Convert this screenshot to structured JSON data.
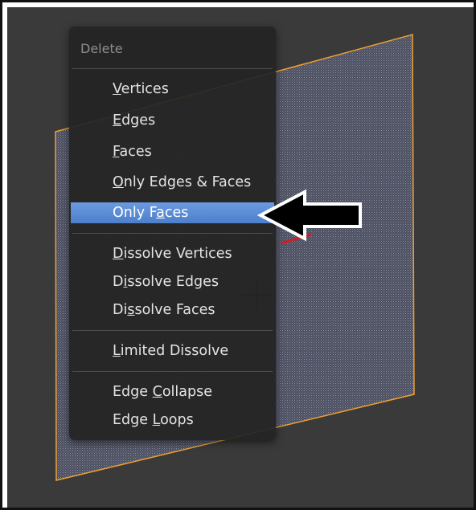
{
  "menu": {
    "title": "Delete",
    "items": [
      {
        "pre": "",
        "key": "V",
        "post": "ertices"
      },
      {
        "pre": "",
        "key": "E",
        "post": "dges"
      },
      {
        "pre": "",
        "key": "F",
        "post": "aces"
      },
      {
        "pre": "",
        "key": "O",
        "post": "nly Edges & Faces"
      },
      {
        "pre": "Only F",
        "key": "a",
        "post": "ces"
      },
      {
        "pre": "",
        "key": "D",
        "post": "issolve Vertices"
      },
      {
        "pre": "D",
        "key": "i",
        "post": "ssolve Edges"
      },
      {
        "pre": "Di",
        "key": "s",
        "post": "solve Faces"
      },
      {
        "pre": "",
        "key": "L",
        "post": "imited Dissolve"
      },
      {
        "pre": "Edge ",
        "key": "C",
        "post": "ollapse"
      },
      {
        "pre": "Edge ",
        "key": "L",
        "post": "oops"
      }
    ],
    "active_item": "Only Faces"
  },
  "colors": {
    "viewport_bg": "#3a3a3a",
    "plane_outline": "#f0a030",
    "menu_highlight": "#5b8ad6"
  },
  "icons": {
    "pointer": "left-arrow-icon"
  }
}
